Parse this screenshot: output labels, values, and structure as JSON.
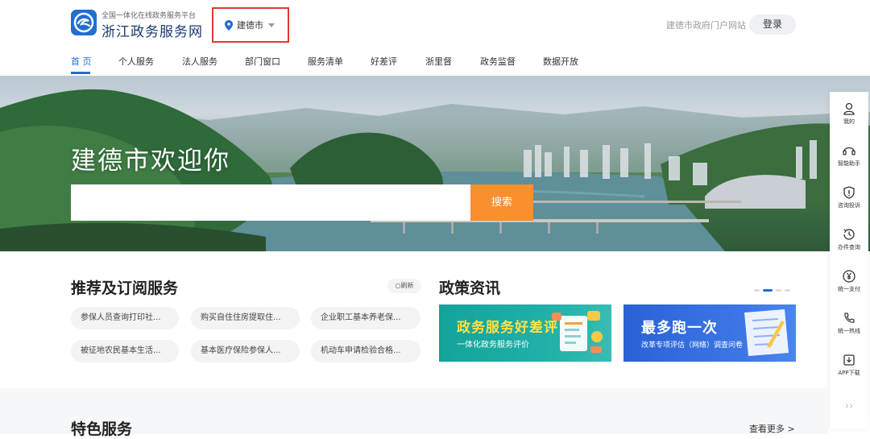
{
  "header": {
    "platform_subtitle": "全国一体化在线政务服务平台",
    "site_title": "浙江政务服务网",
    "city": "建德市",
    "portal_link": "建德市政府门户网站",
    "login": "登录"
  },
  "nav": {
    "items": [
      "首 页",
      "个人服务",
      "法人服务",
      "部门窗口",
      "服务清单",
      "好差评",
      "浙里督",
      "政务监督",
      "数据开放"
    ],
    "active_index": 0
  },
  "banner": {
    "welcome": "建德市欢迎你",
    "search_placeholder": "",
    "search_button": "搜索"
  },
  "recommend": {
    "title": "推荐及订阅服务",
    "refresh": "刷新",
    "services": [
      "参保人员查询打印社...",
      "购买自住住房提取住...",
      "企业职工基本养老保...",
      "被征地农民基本生活...",
      "基本医疗保险参保人...",
      "机动车申请检验合格..."
    ]
  },
  "news": {
    "title": "政策资讯",
    "cards": [
      {
        "title": "政务服务好差评",
        "subtitle": "一体化政务服务评价"
      },
      {
        "title": "最多跑一次",
        "subtitle": "改革专项评估（网络）调查问卷"
      }
    ]
  },
  "featured": {
    "title": "特色服务",
    "see_more": "查看更多 >"
  },
  "toolbar": {
    "items": [
      "我的",
      "智能助手",
      "咨询投诉",
      "办件查询",
      "统一支付",
      "统一热线",
      "APP下载"
    ],
    "more": "››"
  },
  "colors": {
    "primary": "#1f6fd1",
    "search_button": "#f7902d",
    "highlight_box": "#e03a2f"
  }
}
